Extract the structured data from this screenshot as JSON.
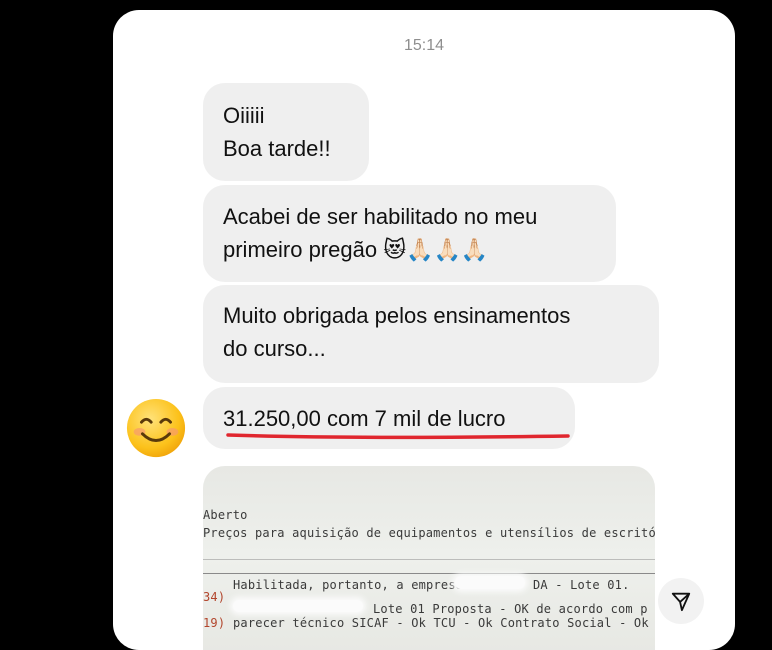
{
  "chat": {
    "timestamp": "15:14",
    "messages": [
      {
        "text": "Oiiiii\nBoa tarde!!"
      },
      {
        "text": "Acabei de ser habilitado no meu\nprimeiro pregão 😻🙏🏻🙏🏻🙏🏻"
      },
      {
        "text": "Muito obrigada pelos ensinamentos\ndo curso..."
      },
      {
        "text": "31.250,00 com 7 mil de lucro"
      }
    ],
    "avatar_emoji": "smiling-face-icon",
    "accent_underline_color": "#e0262e"
  },
  "photo": {
    "line1": "Aberto",
    "line2": "Preços para aquisição de equipamentos e utensílios de escritório",
    "line3_prefix": "34)",
    "line3": "Habilitada, portanto, a empresa",
    "line3_suffix": "DA - Lote 01.",
    "line4": "Lote 01 Proposta - OK de acordo com p",
    "line5_prefix": "19)",
    "line5": "parecer técnico SICAF - Ok TCU - Ok Contrato Social - Ok Doc"
  }
}
